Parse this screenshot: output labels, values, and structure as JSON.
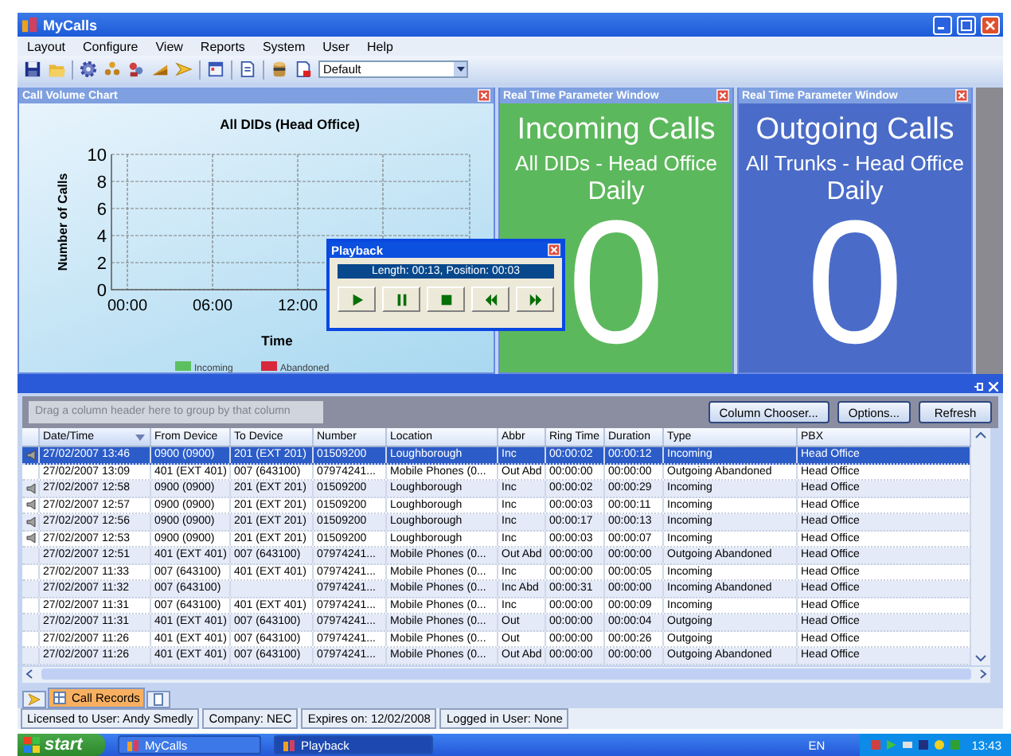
{
  "window": {
    "title": "MyCalls"
  },
  "menu": [
    "Layout",
    "Configure",
    "View",
    "Reports",
    "System",
    "User",
    "Help"
  ],
  "toolbar": {
    "layout_select": "Default"
  },
  "chart_panel": {
    "title": "Call Volume Chart",
    "chart_data": {
      "type": "line",
      "title": "All DIDs (Head Office)",
      "xlabel": "Time",
      "ylabel": "Number of Calls",
      "grid": true,
      "categories": [
        "00:00",
        "06:00",
        "12:00"
      ],
      "ylim": [
        0,
        10
      ],
      "yticks": [
        0,
        2,
        4,
        6,
        8,
        10
      ],
      "series": [
        {
          "name": "Incoming",
          "color": "#5cc060",
          "values": [
            null,
            null,
            null
          ]
        },
        {
          "name": "Abandoned",
          "color": "#d8283c",
          "values": [
            null,
            null,
            null
          ]
        }
      ]
    }
  },
  "realtime_panels": [
    {
      "title": "Real Time Parameter Window",
      "heading": "Incoming Calls",
      "scope": "All DIDs - Head Office",
      "period": "Daily",
      "value": "0",
      "color": "#5cb85c"
    },
    {
      "title": "Real Time Parameter Window",
      "heading": "Outgoing Calls",
      "scope": "All Trunks - Head Office",
      "period": "Daily",
      "value": "0",
      "color": "#4a6cc8"
    }
  ],
  "playback": {
    "title": "Playback",
    "info": "Length: 00:13, Position: 00:03",
    "buttons": [
      {
        "kind": "play"
      },
      {
        "kind": "pause"
      },
      {
        "kind": "stop"
      },
      {
        "kind": "rewind"
      },
      {
        "kind": "forward"
      }
    ]
  },
  "grid": {
    "group_hint": "Drag a column header here to group by that column",
    "buttons": [
      "Column Chooser...",
      "Options...",
      "Refresh"
    ],
    "columns": [
      {
        "label": "Date/Time",
        "sorted": true
      },
      {
        "label": "From Device",
        "sorted": false
      },
      {
        "label": "To Device",
        "sorted": false
      },
      {
        "label": "Number",
        "sorted": false
      },
      {
        "label": "Location",
        "sorted": false
      },
      {
        "label": "Abbr",
        "sorted": false
      },
      {
        "label": "Ring Time",
        "sorted": false
      },
      {
        "label": "Duration",
        "sorted": false
      },
      {
        "label": "Type",
        "sorted": false
      },
      {
        "label": "PBX",
        "sorted": false
      }
    ],
    "rows": [
      {
        "selected": true,
        "recording": true,
        "cells": [
          "27/02/2007 13:46",
          "0900 (0900)",
          "201 (EXT 201)",
          "01509200",
          "Loughborough",
          "Inc",
          "00:00:02",
          "00:00:12",
          "Incoming",
          "Head Office"
        ]
      },
      {
        "selected": false,
        "recording": false,
        "cells": [
          "27/02/2007 13:09",
          "401 (EXT 401)",
          "007 (643100)",
          "07974241...",
          "Mobile Phones (0...",
          "Out Abd",
          "00:00:00",
          "00:00:00",
          "Outgoing Abandoned",
          "Head Office"
        ]
      },
      {
        "selected": false,
        "recording": true,
        "cells": [
          "27/02/2007 12:58",
          "0900 (0900)",
          "201 (EXT 201)",
          "01509200",
          "Loughborough",
          "Inc",
          "00:00:02",
          "00:00:29",
          "Incoming",
          "Head Office"
        ]
      },
      {
        "selected": false,
        "recording": true,
        "cells": [
          "27/02/2007 12:57",
          "0900 (0900)",
          "201 (EXT 201)",
          "01509200",
          "Loughborough",
          "Inc",
          "00:00:03",
          "00:00:11",
          "Incoming",
          "Head Office"
        ]
      },
      {
        "selected": false,
        "recording": true,
        "cells": [
          "27/02/2007 12:56",
          "0900 (0900)",
          "201 (EXT 201)",
          "01509200",
          "Loughborough",
          "Inc",
          "00:00:17",
          "00:00:13",
          "Incoming",
          "Head Office"
        ]
      },
      {
        "selected": false,
        "recording": true,
        "cells": [
          "27/02/2007 12:53",
          "0900 (0900)",
          "201 (EXT 201)",
          "01509200",
          "Loughborough",
          "Inc",
          "00:00:03",
          "00:00:07",
          "Incoming",
          "Head Office"
        ]
      },
      {
        "selected": false,
        "recording": false,
        "cells": [
          "27/02/2007 12:51",
          "401 (EXT 401)",
          "007 (643100)",
          "07974241...",
          "Mobile Phones (0...",
          "Out Abd",
          "00:00:00",
          "00:00:00",
          "Outgoing Abandoned",
          "Head Office"
        ]
      },
      {
        "selected": false,
        "recording": false,
        "cells": [
          "27/02/2007 11:33",
          "007 (643100)",
          "401 (EXT 401)",
          "07974241...",
          "Mobile Phones (0...",
          "Inc",
          "00:00:00",
          "00:00:05",
          "Incoming",
          "Head Office"
        ]
      },
      {
        "selected": false,
        "recording": false,
        "cells": [
          "27/02/2007 11:32",
          "007 (643100)",
          null,
          "07974241...",
          "Mobile Phones (0...",
          "Inc Abd",
          "00:00:31",
          "00:00:00",
          "Incoming Abandoned",
          "Head Office"
        ]
      },
      {
        "selected": false,
        "recording": false,
        "cells": [
          "27/02/2007 11:31",
          "007 (643100)",
          "401 (EXT 401)",
          "07974241...",
          "Mobile Phones (0...",
          "Inc",
          "00:00:00",
          "00:00:09",
          "Incoming",
          "Head Office"
        ]
      },
      {
        "selected": false,
        "recording": false,
        "cells": [
          "27/02/2007 11:31",
          "401 (EXT 401)",
          "007 (643100)",
          "07974241...",
          "Mobile Phones (0...",
          "Out",
          "00:00:00",
          "00:00:04",
          "Outgoing",
          "Head Office"
        ]
      },
      {
        "selected": false,
        "recording": false,
        "cells": [
          "27/02/2007 11:26",
          "401 (EXT 401)",
          "007 (643100)",
          "07974241...",
          "Mobile Phones (0...",
          "Out",
          "00:00:00",
          "00:00:26",
          "Outgoing",
          "Head Office"
        ]
      },
      {
        "selected": false,
        "recording": false,
        "cells": [
          "27/02/2007 11:26",
          "401 (EXT 401)",
          "007 (643100)",
          "07974241...",
          "Mobile Phones (0...",
          "Out Abd",
          "00:00:00",
          "00:00:00",
          "Outgoing Abandoned",
          "Head Office"
        ]
      }
    ]
  },
  "bottom_tabs": [
    {
      "kind": "icon",
      "selected": false
    },
    {
      "kind": "text",
      "label": "Call Records",
      "selected": true
    },
    {
      "kind": "icon",
      "selected": false
    }
  ],
  "status_bar": [
    "Licensed to User: Andy Smedly",
    "Company: NEC",
    "Expires on: 12/02/2008",
    "Logged in User: None"
  ],
  "taskbar": {
    "start": "start",
    "tasks": [
      {
        "label": "MyCalls",
        "selected": false
      },
      {
        "label": "Playback",
        "selected": true
      }
    ],
    "language": "EN",
    "clock": "13:43"
  }
}
